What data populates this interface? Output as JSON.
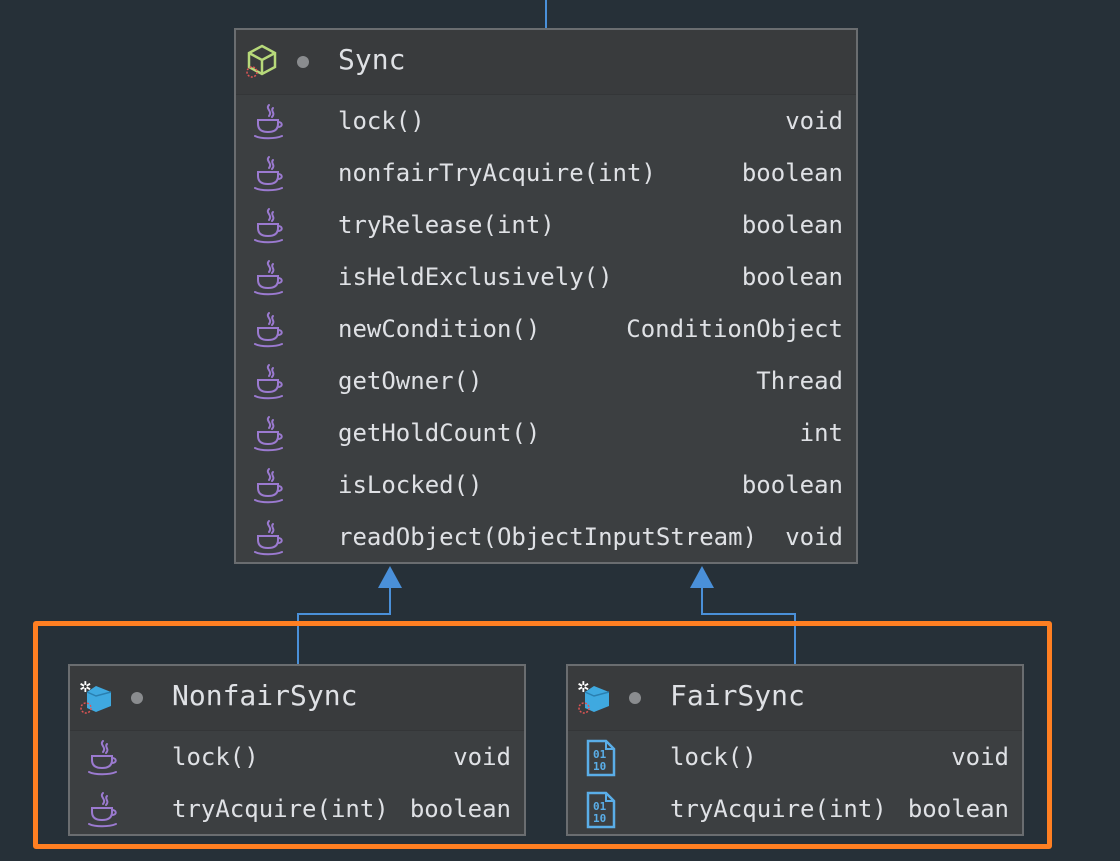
{
  "classes": {
    "sync": {
      "name": "Sync",
      "icon": "abstract-class-icon",
      "methods": [
        {
          "name": "lock()",
          "type": "void",
          "icon": "java-method-icon"
        },
        {
          "name": "nonfairTryAcquire(int)",
          "type": "boolean",
          "icon": "java-method-icon"
        },
        {
          "name": "tryRelease(int)",
          "type": "boolean",
          "icon": "java-method-icon"
        },
        {
          "name": "isHeldExclusively()",
          "type": "boolean",
          "icon": "java-method-icon"
        },
        {
          "name": "newCondition()",
          "type": "ConditionObject",
          "icon": "java-method-icon"
        },
        {
          "name": "getOwner()",
          "type": "Thread",
          "icon": "java-method-icon"
        },
        {
          "name": "getHoldCount()",
          "type": "int",
          "icon": "java-method-icon"
        },
        {
          "name": "isLocked()",
          "type": "boolean",
          "icon": "java-method-icon"
        },
        {
          "name": "readObject(ObjectInputStream)",
          "type": "void",
          "icon": "java-method-icon"
        }
      ]
    },
    "nonfair": {
      "name": "NonfairSync",
      "icon": "static-class-icon",
      "methods": [
        {
          "name": "lock()",
          "type": "void",
          "icon": "java-method-icon"
        },
        {
          "name": "tryAcquire(int)",
          "type": "boolean",
          "icon": "java-method-icon"
        }
      ]
    },
    "fair": {
      "name": "FairSync",
      "icon": "static-class-icon",
      "methods": [
        {
          "name": "lock()",
          "type": "void",
          "icon": "binary-method-icon"
        },
        {
          "name": "tryAcquire(int)",
          "type": "boolean",
          "icon": "binary-method-icon"
        }
      ]
    }
  },
  "colors": {
    "background": "#263038",
    "edge": "#4a90d9",
    "highlight": "#ff7f22",
    "java_icon": "#9b7ad0",
    "abstract_icon": "#b7d97a",
    "static_class_icon": "#3fa9e0"
  }
}
